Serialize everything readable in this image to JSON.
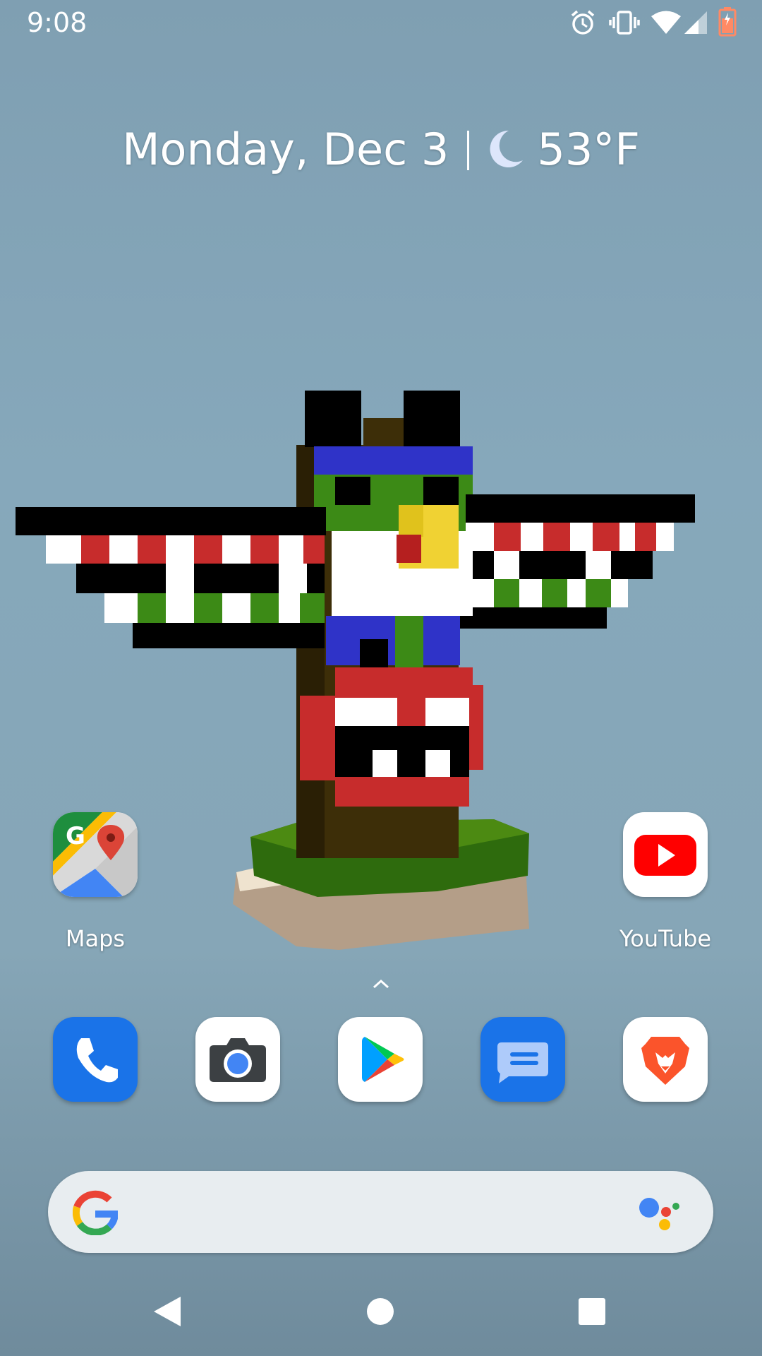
{
  "status_bar": {
    "time": "9:08",
    "icons": [
      "alarm-icon",
      "vibrate-icon",
      "wifi-icon",
      "signal-icon",
      "battery-icon"
    ]
  },
  "glance": {
    "date": "Monday, Dec 3",
    "weather_icon": "moon-icon",
    "temperature": "53°F"
  },
  "wallpaper": {
    "subject": "voxel totem pole"
  },
  "apps": {
    "maps": {
      "label": "Maps"
    },
    "youtube": {
      "label": "YouTube"
    }
  },
  "dock": {
    "indicator": "^",
    "items": [
      "phone-icon",
      "camera-icon",
      "play-store-icon",
      "messages-icon",
      "brave-icon"
    ]
  },
  "search": {
    "logo": "google-g-icon",
    "assistant": "assistant-icon"
  },
  "navbar": [
    "back-button",
    "home-button",
    "recents-button"
  ],
  "colors": {
    "phone_blue": "#1a73e8",
    "messages_blue": "#1a73e8",
    "youtube_red": "#ff0000",
    "brave_orange": "#fb542b"
  }
}
